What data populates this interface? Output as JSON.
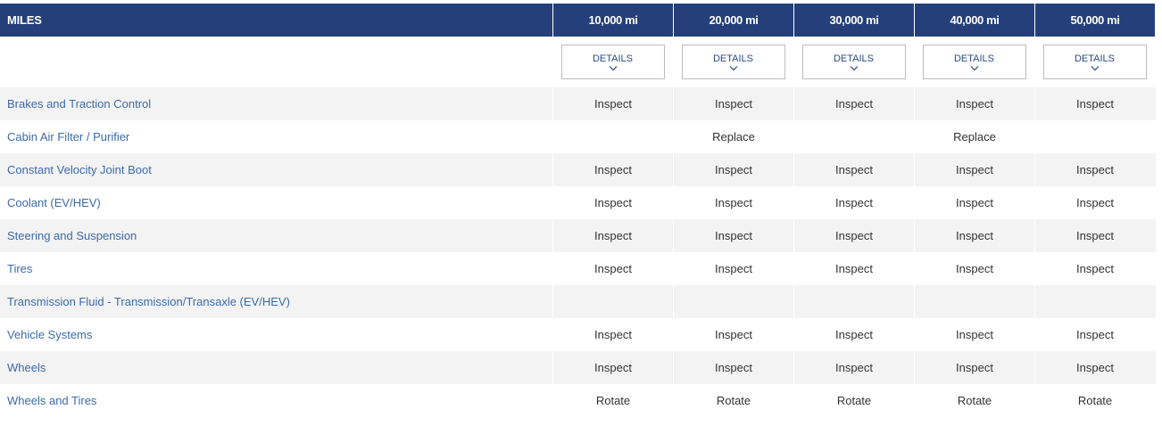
{
  "table": {
    "header_label": "MILES",
    "columns": [
      "10,000 mi",
      "20,000 mi",
      "30,000 mi",
      "40,000 mi",
      "50,000 mi"
    ],
    "details_label": "DETAILS",
    "rows": [
      {
        "label": "Brakes and Traction Control",
        "cells": [
          "Inspect",
          "Inspect",
          "Inspect",
          "Inspect",
          "Inspect"
        ]
      },
      {
        "label": "Cabin Air Filter / Purifier",
        "cells": [
          "",
          "Replace",
          "",
          "Replace",
          ""
        ]
      },
      {
        "label": "Constant Velocity Joint Boot",
        "cells": [
          "Inspect",
          "Inspect",
          "Inspect",
          "Inspect",
          "Inspect"
        ]
      },
      {
        "label": "Coolant (EV/HEV)",
        "cells": [
          "Inspect",
          "Inspect",
          "Inspect",
          "Inspect",
          "Inspect"
        ]
      },
      {
        "label": "Steering and Suspension",
        "cells": [
          "Inspect",
          "Inspect",
          "Inspect",
          "Inspect",
          "Inspect"
        ]
      },
      {
        "label": "Tires",
        "cells": [
          "Inspect",
          "Inspect",
          "Inspect",
          "Inspect",
          "Inspect"
        ]
      },
      {
        "label": "Transmission Fluid - Transmission/Transaxle (EV/HEV)",
        "cells": [
          "",
          "",
          "",
          "",
          ""
        ]
      },
      {
        "label": "Vehicle Systems",
        "cells": [
          "Inspect",
          "Inspect",
          "Inspect",
          "Inspect",
          "Inspect"
        ]
      },
      {
        "label": "Wheels",
        "cells": [
          "Inspect",
          "Inspect",
          "Inspect",
          "Inspect",
          "Inspect"
        ]
      },
      {
        "label": "Wheels and Tires",
        "cells": [
          "Rotate",
          "Rotate",
          "Rotate",
          "Rotate",
          "Rotate"
        ]
      }
    ]
  },
  "icons": {
    "details_chevron": "chevron-down-icon"
  },
  "colors": {
    "header_bg": "#243f7a",
    "header_text": "#ffffff",
    "row_label": "#3b6aa8",
    "alt_row_bg": "#f3f3f3",
    "button_text": "#2a4a86",
    "button_border": "#b9bcc2"
  }
}
